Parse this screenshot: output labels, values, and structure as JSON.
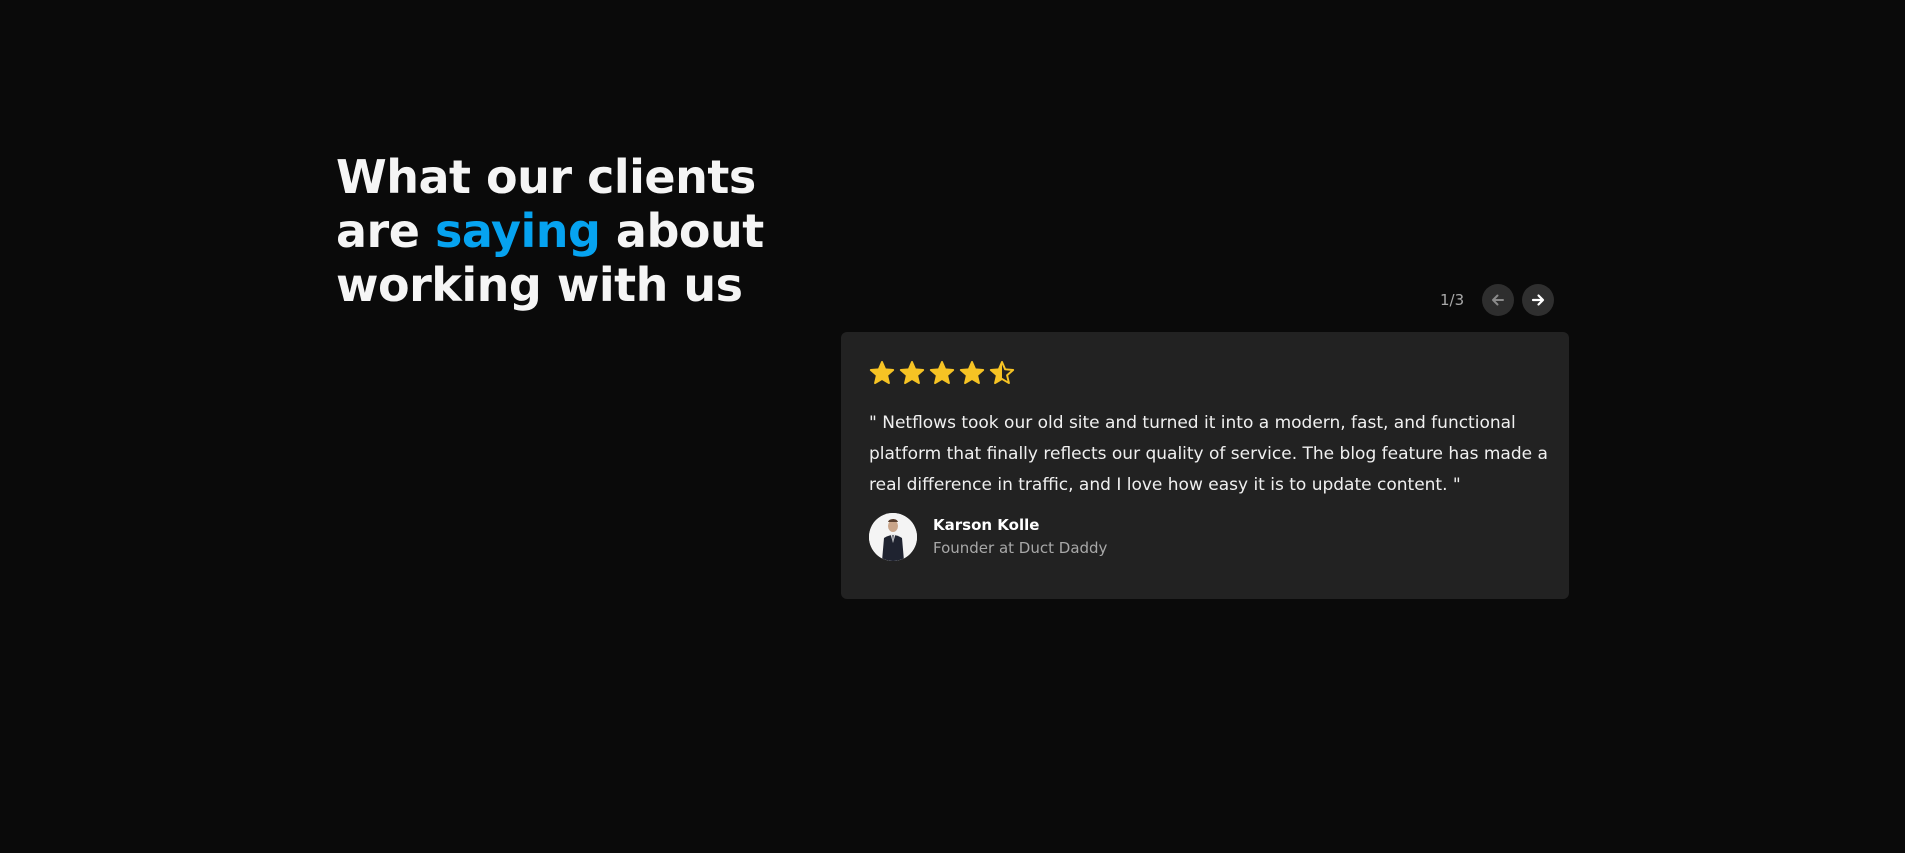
{
  "heading": {
    "part1": "What our clients are ",
    "accent": "saying",
    "part2": " about working with us"
  },
  "pager": {
    "current_label": "1/3",
    "prev_icon": "arrow-left-icon",
    "next_icon": "arrow-right-icon"
  },
  "testimonial": {
    "rating": 4.5,
    "rating_max": 5,
    "star_color": "#f6c324",
    "quote": "\" Netflows took our old site and turned it into a modern, fast, and functional platform that finally reflects our quality of service. The blog feature has made a real difference in traffic, and I love how easy it is to update content. \"",
    "author_name": "Karson Kolle",
    "author_role": "Founder at Duct Daddy"
  },
  "colors": {
    "background": "#0a0a0a",
    "card": "#222222",
    "accent": "#06a3f0"
  }
}
